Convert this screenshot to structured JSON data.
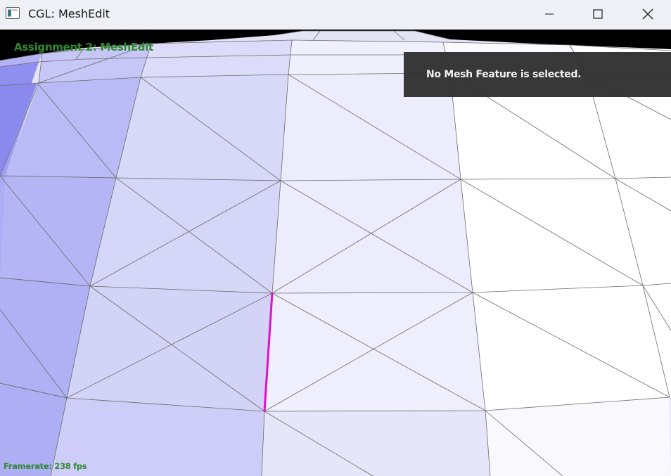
{
  "window": {
    "title": "CGL: MeshEdit",
    "icon": "app-window-icon",
    "controls": [
      "minimize-icon",
      "maximize-icon",
      "close-icon"
    ]
  },
  "viewport": {
    "app_label": "Assignment 2: MeshEdit",
    "info_panel_text": "No Mesh Feature is selected.",
    "framerate_text": "Framerate: 238 fps"
  },
  "colors": {
    "titlebar_bg": "#eef0f5",
    "label_green": "#2f8a2f",
    "panel_bg": "#303030",
    "highlight_edge": "#e010c8",
    "mesh_line": "#6b6b6b"
  }
}
